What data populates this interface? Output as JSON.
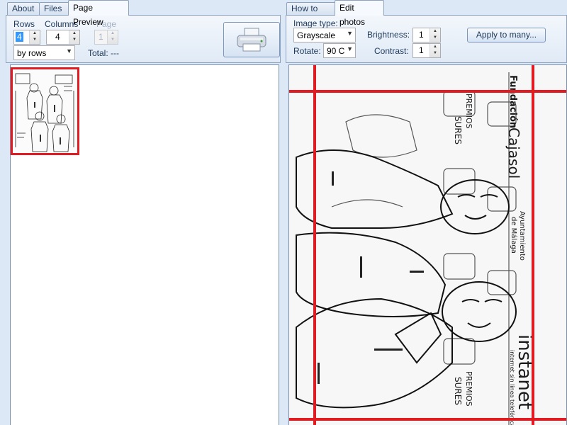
{
  "left_tabs": [
    {
      "label": "About"
    },
    {
      "label": "Files"
    },
    {
      "label": "Page Preview"
    }
  ],
  "right_tabs": [
    {
      "label": "How to use"
    },
    {
      "label": "Edit photos"
    }
  ],
  "page_preview": {
    "rows_label": "Rows",
    "rows_value": "4",
    "columns_label": "Columns",
    "columns_value": "4",
    "page_label": "Page",
    "page_value": "1",
    "order_value": "by rows",
    "total_label": "Total: ---",
    "print_icon": "printer-icon"
  },
  "edit_photos": {
    "image_type_label": "Image type:",
    "image_type_value": "Grayscale",
    "rotate_label": "Rotate:",
    "rotate_value": "90 C",
    "brightness_label": "Brightness:",
    "brightness_value": "1",
    "contrast_label": "Contrast:",
    "contrast_value": "1",
    "apply_button": "Apply to many..."
  },
  "photo_text": {
    "foundation": "Fundación",
    "cajasol": "Cajasol",
    "ayuntamiento": "Ayuntamiento",
    "malaga": "de Málaga",
    "premios": "PREMIOS",
    "sures": "SURES",
    "instanet": "instanet",
    "internet": "internet sin línea telefónica"
  },
  "colors": {
    "selection_red": "#e11b22",
    "panel_blue": "#dce8f5"
  }
}
